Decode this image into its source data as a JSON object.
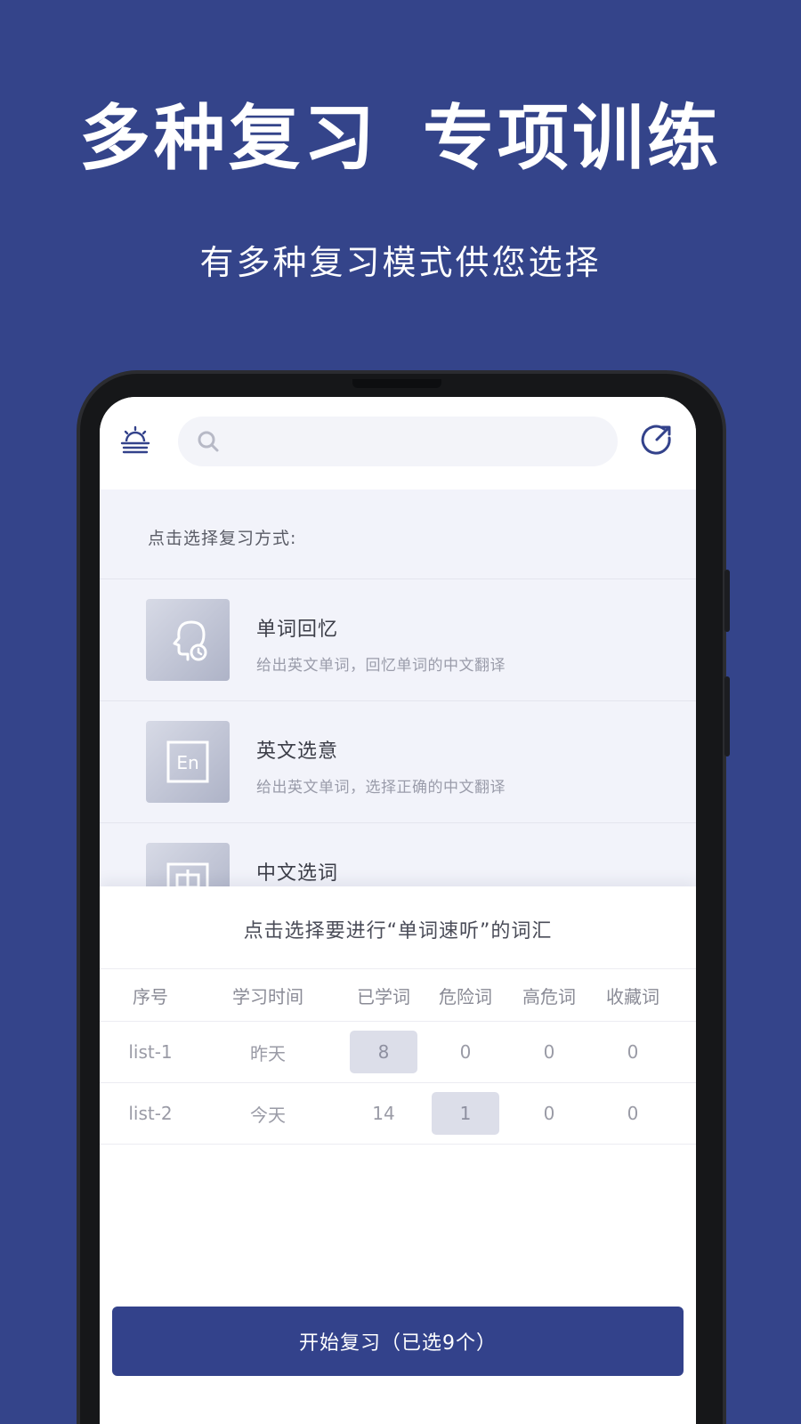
{
  "banner": {
    "headline_left": "多种复习",
    "headline_right": "专项训练",
    "subline": "有多种复习模式供您选择"
  },
  "topbar": {
    "left_icon": "sunrise-icon",
    "search_icon": "search-icon",
    "search_placeholder": "",
    "right_icon": "share-icon"
  },
  "review": {
    "title": "点击选择复习方式:",
    "modes": [
      {
        "name": "单词回忆",
        "desc": "给出英文单词，回忆单词的中文翻译",
        "icon": "head-clock-icon"
      },
      {
        "name": "英文选意",
        "desc": "给出英文单词，选择正确的中文翻译",
        "icon": "en-icon"
      },
      {
        "name": "中文选词",
        "desc": "",
        "icon": "zh-icon"
      }
    ]
  },
  "sheet": {
    "title": "点击选择要进行“单词速听”的词汇",
    "columns": [
      "序号",
      "学习时间",
      "已学词",
      "危险词",
      "高危词",
      "收藏词"
    ],
    "rows": [
      {
        "id": "list-1",
        "time": "昨天",
        "learned": "8",
        "danger": "0",
        "high": "0",
        "fav": "0"
      },
      {
        "id": "list-2",
        "time": "今天",
        "learned": "14",
        "danger": "1",
        "high": "0",
        "fav": "0"
      }
    ],
    "selected_cells": [
      {
        "row": 0,
        "column": "已学词"
      },
      {
        "row": 1,
        "column": "危险词"
      }
    ],
    "start_button": "开始复习（已选9个）"
  },
  "colors": {
    "background": "#34448a",
    "accent": "#33428b",
    "chip": "#dcdee9"
  }
}
